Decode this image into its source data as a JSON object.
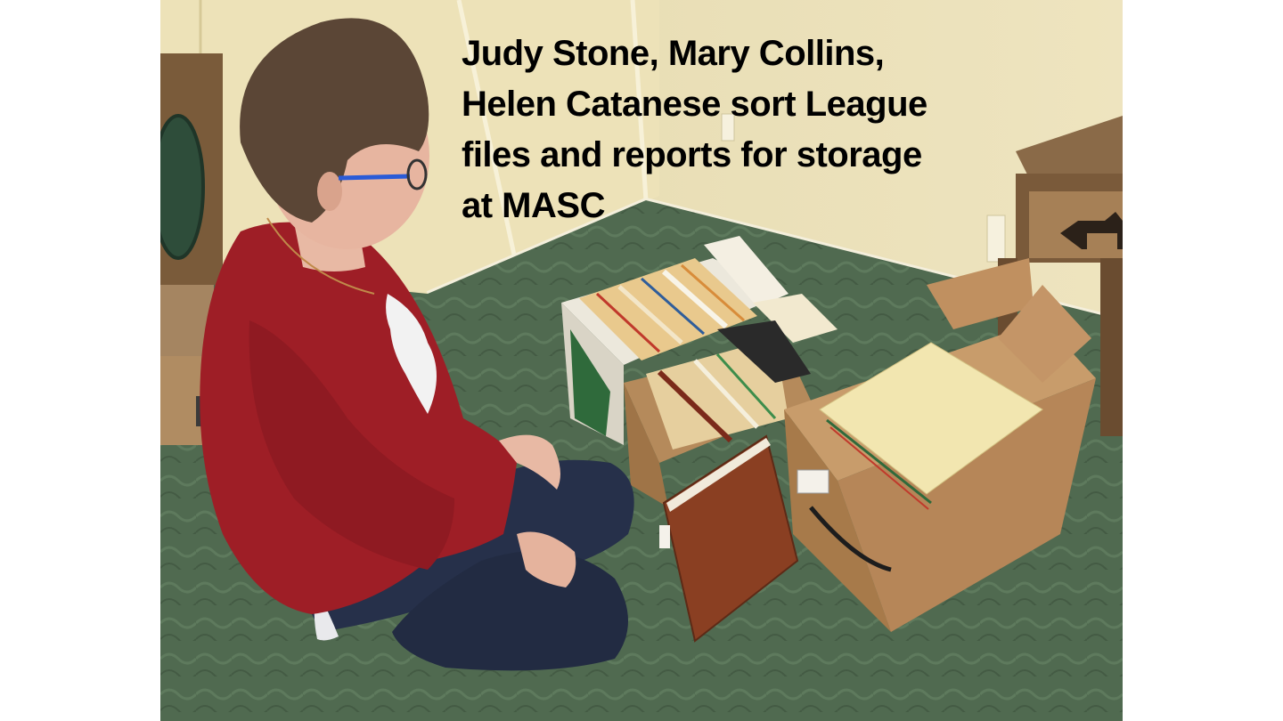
{
  "caption": {
    "lines": [
      "Judy Stone, Mary Collins,",
      "Helen Catanese sort League",
      "files and reports for storage",
      "at MASC"
    ]
  },
  "colors": {
    "wall": "#e9dfb6",
    "carpet": "#4f6a4f",
    "sweatshirt": "#9e1e26",
    "jeans": "#26304a",
    "cardboard": "#b48a5e",
    "folder": "#f1e7b4",
    "binder": "#8a3f22",
    "hair": "#5b4636",
    "glasses": "#2a5bd7",
    "side_table": "#6e5136"
  }
}
